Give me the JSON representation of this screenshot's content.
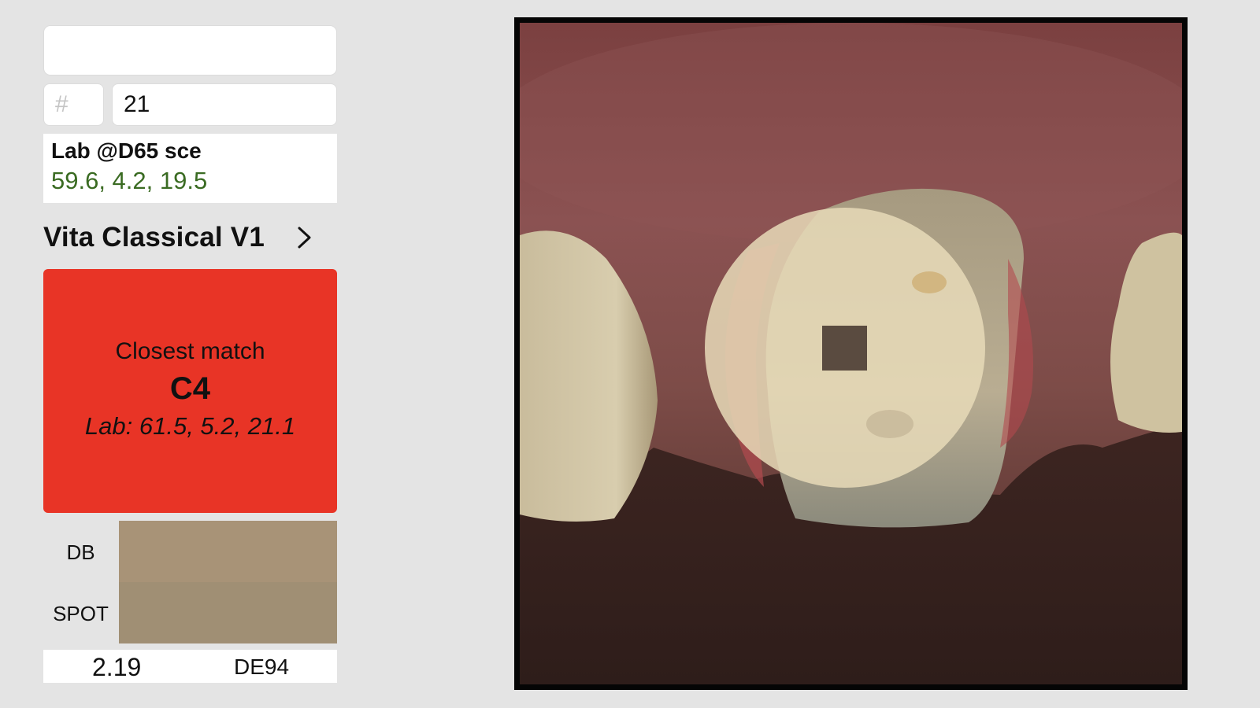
{
  "form": {
    "title_value": "",
    "hash_placeholder": "#",
    "tooth_number": "21"
  },
  "lab": {
    "title": "Lab @D65 sce",
    "values": "59.6, 4.2, 19.5"
  },
  "shade_guide": {
    "label": "Vita Classical V1",
    "chevron_icon": "chevron-right-icon"
  },
  "match": {
    "caption": "Closest match",
    "code": "C4",
    "lab": "Lab: 61.5, 5.2, 21.1",
    "background_color": "#e83426"
  },
  "compare": {
    "db_label": "DB",
    "spot_label": "SPOT",
    "db_color": "#a89377",
    "spot_color": "#a08f74"
  },
  "delta_e": {
    "value": "2.19",
    "unit": "DE94"
  },
  "photo": {
    "subject": "tooth-photo",
    "sample_spot_color": "#5a4b40"
  }
}
